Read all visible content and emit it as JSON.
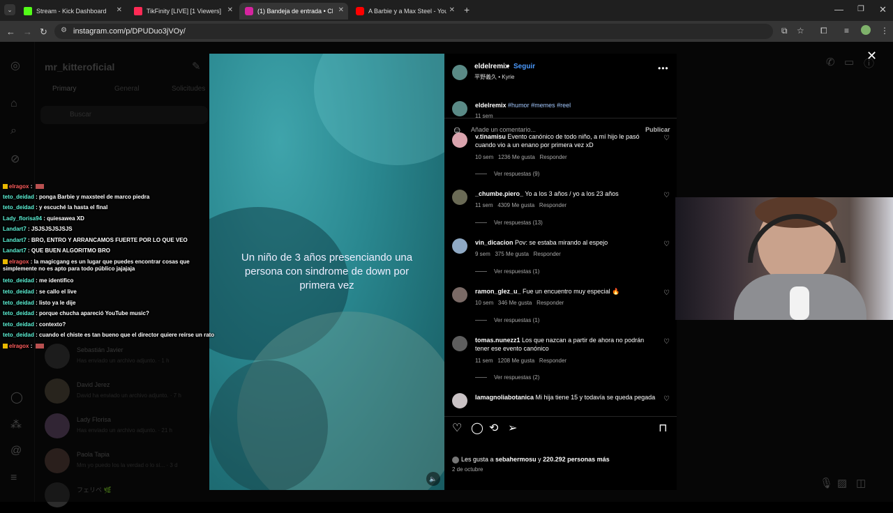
{
  "browser": {
    "tabs": [
      {
        "title": "Stream - Kick Dashboard",
        "color": "#53fc18"
      },
      {
        "title": "TikFinity [LIVE] [1 Viewers]",
        "color": "#ff2a55"
      },
      {
        "title": "(1) Bandeja de entrada • Ch",
        "color": "#d6249f"
      },
      {
        "title": "A Barbie y a Max Steel - YouTu",
        "color": "#ff0000"
      }
    ],
    "url": "instagram.com/p/DPUDuo3jVOy/"
  },
  "instagram_bg": {
    "username": "mr_kitteroficial",
    "dm_tabs": [
      "Primary",
      "General",
      "Solicitudes"
    ],
    "search_placeholder": "Buscar",
    "conversations": [
      {
        "name": "Sebastián Javier",
        "sub": "Has enviado un archivo adjunto. · 1 h"
      },
      {
        "name": "David Jerez",
        "sub": "David ha enviado un archivo adjunto. · 7 h"
      },
      {
        "name": "Lady Florisa",
        "sub": "Has enviado un archivo adjunto. · 21 h"
      },
      {
        "name": "Paola Tapia",
        "sub": "Mm yo puedo los la verdad o lo sí... · 3 d"
      },
      {
        "name": "フェリペ 🌿",
        "sub": ""
      }
    ]
  },
  "post": {
    "author": "eldelremix",
    "follow_label": "Seguir",
    "audio": "平野義久 • Kyrie",
    "video_caption": "Un niño de 3 años presenciando una persona con sindrome de down por primera vez",
    "description_user": "eldelremix",
    "description_tags": "#humor #memes #reel",
    "description_time": "11 sem",
    "comments": [
      {
        "user": "v.tinamisu",
        "text": "Evento canónico de todo niño, a mí hijo le pasó cuando vio a un enano por primera vez xD",
        "time": "10 sem",
        "likes": "1236 Me gusta",
        "reply": "Responder",
        "replies": "Ver respuestas (9)"
      },
      {
        "user": "_chumbe.piero_",
        "text": "Yo a los 3 años / yo a los 23 años",
        "time": "11 sem",
        "likes": "4309 Me gusta",
        "reply": "Responder",
        "replies": "Ver respuestas (13)"
      },
      {
        "user": "vin_dicacion",
        "text": "Pov: se estaba mirando al espejo",
        "time": "9 sem",
        "likes": "375 Me gusta",
        "reply": "Responder",
        "replies": "Ver respuestas (1)"
      },
      {
        "user": "ramon_glez_u_",
        "text": "Fue un encuentro muy especial 🔥",
        "time": "10 sem",
        "likes": "346 Me gusta",
        "reply": "Responder",
        "replies": "Ver respuestas (1)"
      },
      {
        "user": "tomas.nunezz1",
        "text": "Los que nazcan a partir de ahora no podrán tener ese evento canónico",
        "time": "11 sem",
        "likes": "1208 Me gusta",
        "reply": "Responder",
        "replies": "Ver respuestas (2)"
      },
      {
        "user": "lamagnoliabotanica",
        "text": "Mi hija tiene 15 y todavía se queda pegada",
        "time": "",
        "likes": "",
        "reply": "",
        "replies": ""
      }
    ],
    "likes_prefix": "Les gusta a ",
    "likes_user": "sebahermosu",
    "likes_mid": " y ",
    "likes_count": "220.292 personas más",
    "date": "2 de octubre",
    "comment_placeholder": "Añade un comentario...",
    "publish_label": "Publicar"
  },
  "chat": [
    {
      "user": "elragox",
      "msg": "",
      "badge": true
    },
    {
      "user": "teto_deidad",
      "msg": "ponga Barbie y maxsteel de marco piedra"
    },
    {
      "user": "teto_deidad",
      "msg": "y escuché la hasta el final"
    },
    {
      "user": "Lady_florisa94",
      "msg": "quiesawea XD"
    },
    {
      "user": "Landart7",
      "msg": "JSJSJSJSJSJS"
    },
    {
      "user": "Landart7",
      "msg": "BRO, ENTRO Y ARRANCAMOS FUERTE POR LO QUE VEO"
    },
    {
      "user": "Landart7",
      "msg": "QUE BUEN ALGORITMO BRO"
    },
    {
      "user": "elragox",
      "msg": "la magicgang es un lugar que puedes encontrar cosas que simplemente no es apto para todo público jajajaja",
      "badge": true
    },
    {
      "user": "teto_deidad",
      "msg": "me identifico"
    },
    {
      "user": "teto_deidad",
      "msg": "se callo el live"
    },
    {
      "user": "teto_deidad",
      "msg": "listo ya le dije"
    },
    {
      "user": "teto_deidad",
      "msg": "porque chucha apareció YouTube music?"
    },
    {
      "user": "teto_deidad",
      "msg": "contexto?"
    },
    {
      "user": "teto_deidad",
      "msg": "cuando el chiste es tan bueno que el director quiere reírse un rato"
    },
    {
      "user": "elragox",
      "msg": "",
      "badge": true
    }
  ]
}
